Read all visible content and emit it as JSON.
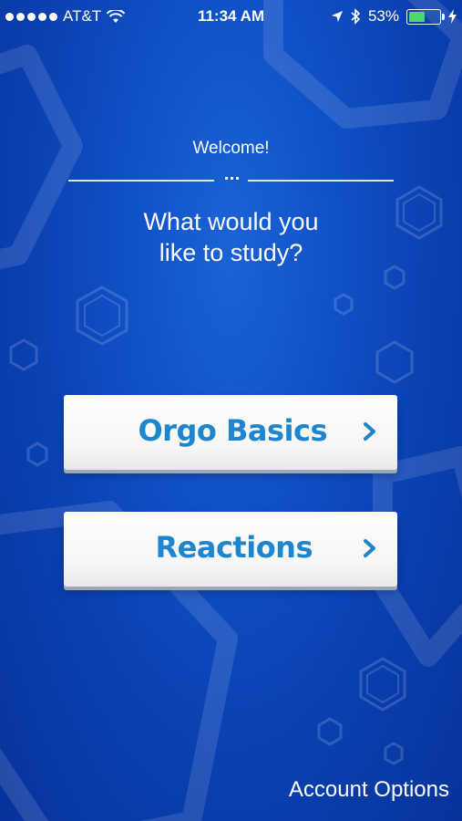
{
  "status_bar": {
    "carrier": "AT&T",
    "time": "11:34 AM",
    "battery_percent": "53%",
    "battery_level": 0.53,
    "icons": [
      "signal-dots-icon",
      "wifi-icon",
      "location-arrow-icon",
      "bluetooth-icon",
      "battery-icon",
      "charging-bolt-icon"
    ]
  },
  "welcome": "Welcome!",
  "headline_line1": "What would you",
  "headline_line2": "like to study?",
  "options": [
    {
      "label": "Orgo Basics",
      "icon": "chevron-right-icon"
    },
    {
      "label": "Reactions",
      "icon": "chevron-right-icon"
    }
  ],
  "account_options": "Account Options",
  "colors": {
    "background": "#0f4fc4",
    "button_text": "#1d86cf",
    "battery_fill": "#4cd964"
  }
}
